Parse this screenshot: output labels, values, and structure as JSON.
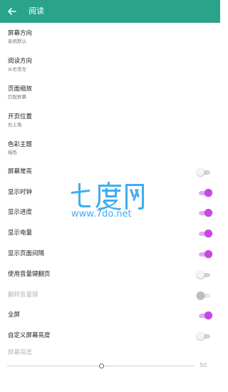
{
  "appbar": {
    "title": "阅读",
    "back_icon": "arrow-left-icon",
    "background": "#2aa38b"
  },
  "settings": [
    {
      "title": "屏幕方向",
      "subtitle": "系统默认"
    },
    {
      "title": "阅读方向",
      "subtitle": "从右至左"
    },
    {
      "title": "页面缩放",
      "subtitle": "匹配屏幕"
    },
    {
      "title": "开页位置",
      "subtitle": "右上角"
    },
    {
      "title": "色彩主题",
      "subtitle": "暗色"
    },
    {
      "title": "屏幕常亮",
      "switch": false
    },
    {
      "title": "显示时钟",
      "switch": true
    },
    {
      "title": "显示进度",
      "switch": true
    },
    {
      "title": "显示电量",
      "switch": true
    },
    {
      "title": "显示页面间隔",
      "switch": true
    },
    {
      "title": "使用音量键翻页",
      "switch": false
    },
    {
      "title": "翻转音量键",
      "switch": false,
      "disabled": true
    },
    {
      "title": "全屏",
      "switch": true
    },
    {
      "title": "自定义屏幕亮度",
      "switch": false
    },
    {
      "title": "屏幕亮度",
      "disabled": true
    }
  ],
  "brightness": {
    "value": "50",
    "fraction": 0.5
  },
  "watermark": {
    "name": "七度网",
    "url": "www.7do.net",
    "color": "#1f9ef0"
  },
  "colors": {
    "switch_on": "#cc44e8",
    "switch_on_track": "#dfaef2",
    "switch_off_track": "#d2d2d2"
  }
}
